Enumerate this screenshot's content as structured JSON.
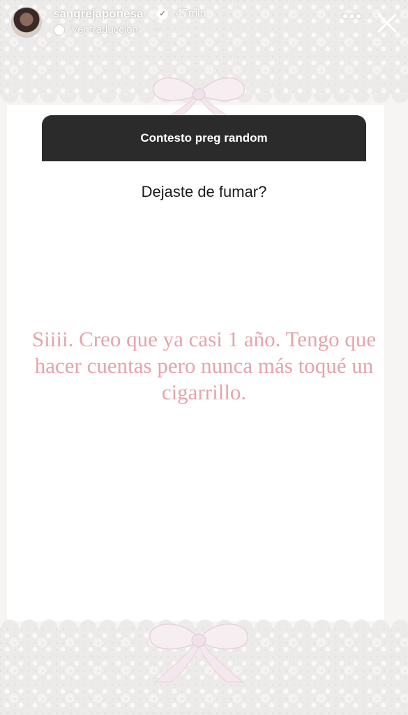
{
  "header": {
    "username": "sangrejaponesa",
    "time_ago": "47min",
    "translate_label": "Ver traducción"
  },
  "question_card": {
    "title": "Contesto preg random",
    "question": "Dejaste de fumar?"
  },
  "answer": {
    "text": "Siiii. Creo que ya casi 1 año. Tengo que hacer cuentas pero nunca más toqué un cigarrillo."
  },
  "colors": {
    "card_header_bg": "#2b2b2b",
    "answer_text": "#e6a4aa",
    "lace": "#ecebea"
  }
}
